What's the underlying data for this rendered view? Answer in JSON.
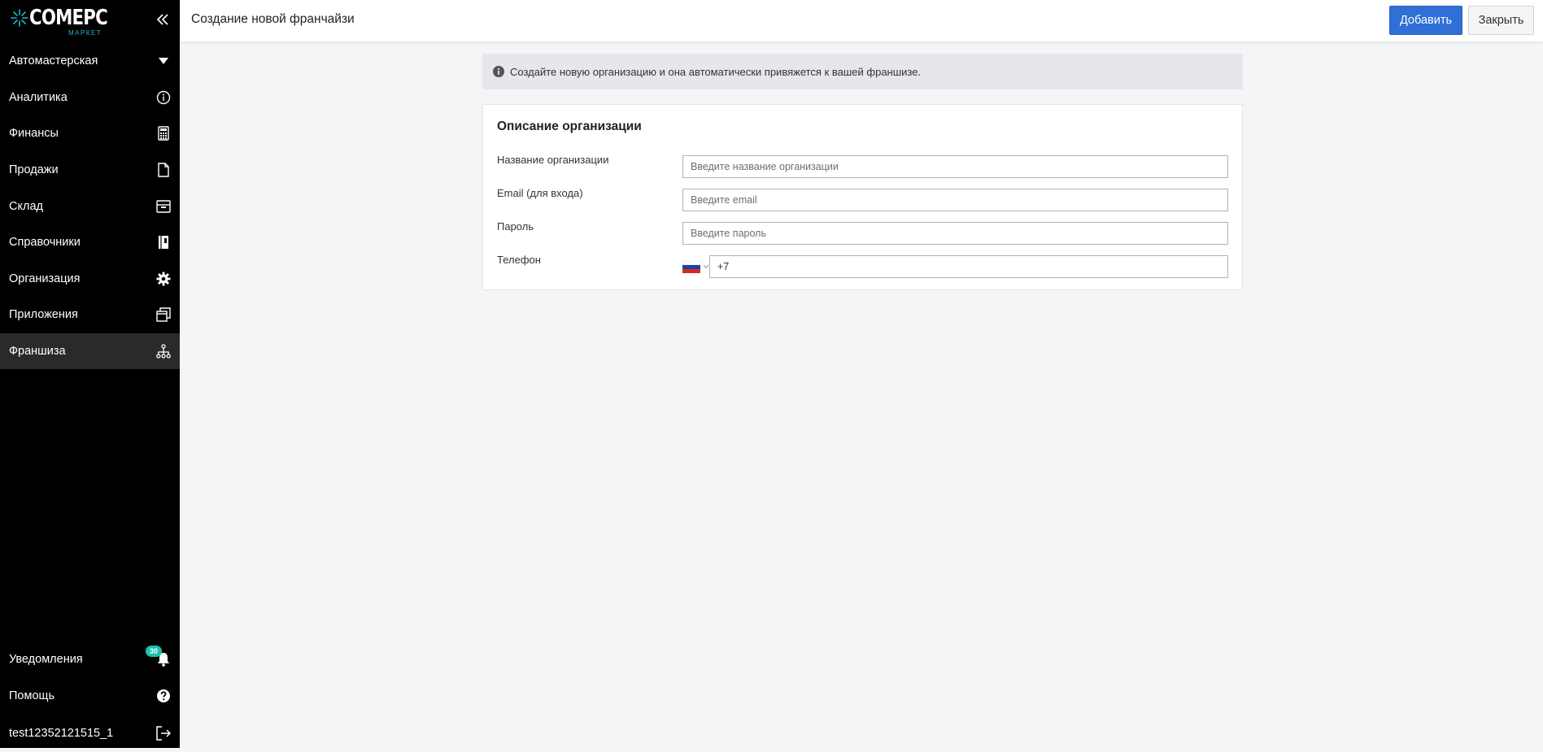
{
  "app": {
    "brand_name": "COMEPC",
    "brand_sub": "МАРКЕТ",
    "accent_color": "#2f6fd6",
    "badge_color": "#19c2b0"
  },
  "sidebar": {
    "company": {
      "label": "Автомастерская",
      "icon": "caret-down-icon"
    },
    "items": [
      {
        "label": "Аналитика",
        "icon": "info-circle-icon"
      },
      {
        "label": "Финансы",
        "icon": "calculator-icon"
      },
      {
        "label": "Продажи",
        "icon": "document-icon"
      },
      {
        "label": "Склад",
        "icon": "box-icon"
      },
      {
        "label": "Справочники",
        "icon": "book-icon"
      },
      {
        "label": "Организация",
        "icon": "gear-icon"
      },
      {
        "label": "Приложения",
        "icon": "windows-icon"
      },
      {
        "label": "Франшиза",
        "icon": "hierarchy-icon",
        "active": true
      }
    ],
    "bottom": {
      "notifications": {
        "label": "Уведомления",
        "badge": "30",
        "icon": "bell-icon"
      },
      "help": {
        "label": "Помощь",
        "icon": "question-circle-icon"
      },
      "user": {
        "label": "test12352121515_1",
        "icon": "logout-icon"
      }
    }
  },
  "header": {
    "title": "Создание новой франчайзи",
    "add_label": "Добавить",
    "close_label": "Закрыть"
  },
  "info": {
    "text": "Создайте новую организацию и она автоматически привяжется к вашей франшизе."
  },
  "form": {
    "title": "Описание организации",
    "name_label": "Название организации",
    "name_placeholder": "Введите название организации",
    "name_value": "",
    "email_label": "Email (для входа)",
    "email_placeholder": "Введите email",
    "email_value": "",
    "password_label": "Пароль",
    "password_placeholder": "Введите пароль",
    "password_value": "",
    "phone_label": "Телефон",
    "phone_value": "+7",
    "phone_country": "RU"
  }
}
